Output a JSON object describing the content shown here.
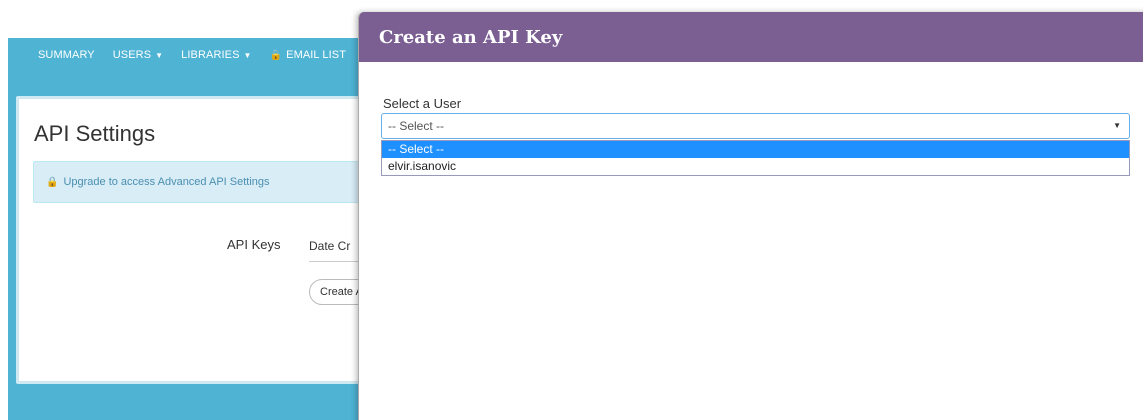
{
  "nav": {
    "items": [
      {
        "label": "SUMMARY",
        "caret": false,
        "lock": false
      },
      {
        "label": "USERS",
        "caret": true,
        "lock": false
      },
      {
        "label": "LIBRARIES",
        "caret": true,
        "lock": false
      },
      {
        "label": "EMAIL LIST",
        "caret": false,
        "lock": true
      }
    ]
  },
  "page": {
    "title": "API Settings",
    "alert": "Upgrade to access Advanced API Settings",
    "api_keys_label": "API Keys",
    "date_column": "Date Cr",
    "create_button": "Create A"
  },
  "modal": {
    "title": "Create an API Key",
    "field_label": "Select a User",
    "select_value": "-- Select --",
    "options": [
      {
        "label": "-- Select --",
        "selected": true
      },
      {
        "label": "elvir.isanovic",
        "selected": false
      }
    ]
  },
  "colors": {
    "nav_background": "#4fb3d4",
    "modal_header": "#7b5f93",
    "selected_option": "#1e90ff",
    "alert_background": "#d9edf7"
  }
}
